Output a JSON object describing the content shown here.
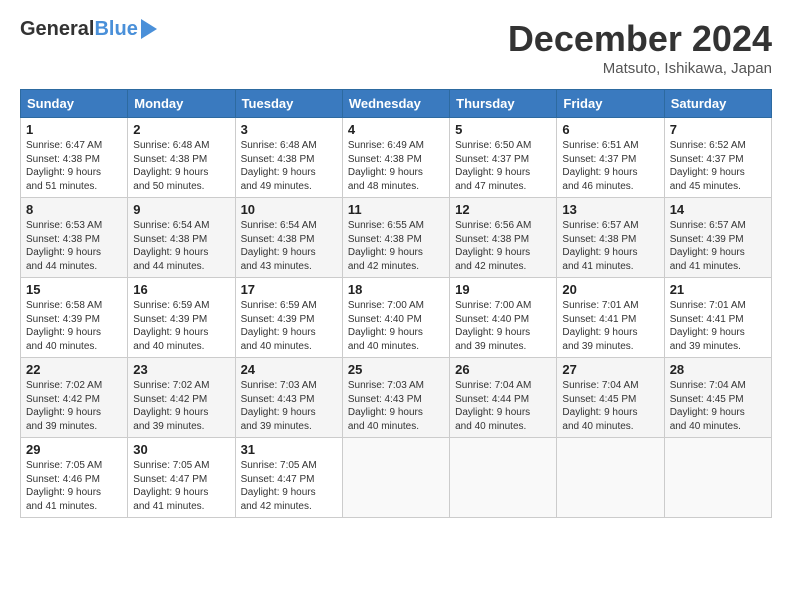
{
  "header": {
    "logo_general": "General",
    "logo_blue": "Blue",
    "title": "December 2024",
    "location": "Matsuto, Ishikawa, Japan"
  },
  "days_of_week": [
    "Sunday",
    "Monday",
    "Tuesday",
    "Wednesday",
    "Thursday",
    "Friday",
    "Saturday"
  ],
  "weeks": [
    [
      {
        "day": "1",
        "info": "Sunrise: 6:47 AM\nSunset: 4:38 PM\nDaylight: 9 hours\nand 51 minutes."
      },
      {
        "day": "2",
        "info": "Sunrise: 6:48 AM\nSunset: 4:38 PM\nDaylight: 9 hours\nand 50 minutes."
      },
      {
        "day": "3",
        "info": "Sunrise: 6:48 AM\nSunset: 4:38 PM\nDaylight: 9 hours\nand 49 minutes."
      },
      {
        "day": "4",
        "info": "Sunrise: 6:49 AM\nSunset: 4:38 PM\nDaylight: 9 hours\nand 48 minutes."
      },
      {
        "day": "5",
        "info": "Sunrise: 6:50 AM\nSunset: 4:37 PM\nDaylight: 9 hours\nand 47 minutes."
      },
      {
        "day": "6",
        "info": "Sunrise: 6:51 AM\nSunset: 4:37 PM\nDaylight: 9 hours\nand 46 minutes."
      },
      {
        "day": "7",
        "info": "Sunrise: 6:52 AM\nSunset: 4:37 PM\nDaylight: 9 hours\nand 45 minutes."
      }
    ],
    [
      {
        "day": "8",
        "info": "Sunrise: 6:53 AM\nSunset: 4:38 PM\nDaylight: 9 hours\nand 44 minutes."
      },
      {
        "day": "9",
        "info": "Sunrise: 6:54 AM\nSunset: 4:38 PM\nDaylight: 9 hours\nand 44 minutes."
      },
      {
        "day": "10",
        "info": "Sunrise: 6:54 AM\nSunset: 4:38 PM\nDaylight: 9 hours\nand 43 minutes."
      },
      {
        "day": "11",
        "info": "Sunrise: 6:55 AM\nSunset: 4:38 PM\nDaylight: 9 hours\nand 42 minutes."
      },
      {
        "day": "12",
        "info": "Sunrise: 6:56 AM\nSunset: 4:38 PM\nDaylight: 9 hours\nand 42 minutes."
      },
      {
        "day": "13",
        "info": "Sunrise: 6:57 AM\nSunset: 4:38 PM\nDaylight: 9 hours\nand 41 minutes."
      },
      {
        "day": "14",
        "info": "Sunrise: 6:57 AM\nSunset: 4:39 PM\nDaylight: 9 hours\nand 41 minutes."
      }
    ],
    [
      {
        "day": "15",
        "info": "Sunrise: 6:58 AM\nSunset: 4:39 PM\nDaylight: 9 hours\nand 40 minutes."
      },
      {
        "day": "16",
        "info": "Sunrise: 6:59 AM\nSunset: 4:39 PM\nDaylight: 9 hours\nand 40 minutes."
      },
      {
        "day": "17",
        "info": "Sunrise: 6:59 AM\nSunset: 4:39 PM\nDaylight: 9 hours\nand 40 minutes."
      },
      {
        "day": "18",
        "info": "Sunrise: 7:00 AM\nSunset: 4:40 PM\nDaylight: 9 hours\nand 40 minutes."
      },
      {
        "day": "19",
        "info": "Sunrise: 7:00 AM\nSunset: 4:40 PM\nDaylight: 9 hours\nand 39 minutes."
      },
      {
        "day": "20",
        "info": "Sunrise: 7:01 AM\nSunset: 4:41 PM\nDaylight: 9 hours\nand 39 minutes."
      },
      {
        "day": "21",
        "info": "Sunrise: 7:01 AM\nSunset: 4:41 PM\nDaylight: 9 hours\nand 39 minutes."
      }
    ],
    [
      {
        "day": "22",
        "info": "Sunrise: 7:02 AM\nSunset: 4:42 PM\nDaylight: 9 hours\nand 39 minutes."
      },
      {
        "day": "23",
        "info": "Sunrise: 7:02 AM\nSunset: 4:42 PM\nDaylight: 9 hours\nand 39 minutes."
      },
      {
        "day": "24",
        "info": "Sunrise: 7:03 AM\nSunset: 4:43 PM\nDaylight: 9 hours\nand 39 minutes."
      },
      {
        "day": "25",
        "info": "Sunrise: 7:03 AM\nSunset: 4:43 PM\nDaylight: 9 hours\nand 40 minutes."
      },
      {
        "day": "26",
        "info": "Sunrise: 7:04 AM\nSunset: 4:44 PM\nDaylight: 9 hours\nand 40 minutes."
      },
      {
        "day": "27",
        "info": "Sunrise: 7:04 AM\nSunset: 4:45 PM\nDaylight: 9 hours\nand 40 minutes."
      },
      {
        "day": "28",
        "info": "Sunrise: 7:04 AM\nSunset: 4:45 PM\nDaylight: 9 hours\nand 40 minutes."
      }
    ],
    [
      {
        "day": "29",
        "info": "Sunrise: 7:05 AM\nSunset: 4:46 PM\nDaylight: 9 hours\nand 41 minutes."
      },
      {
        "day": "30",
        "info": "Sunrise: 7:05 AM\nSunset: 4:47 PM\nDaylight: 9 hours\nand 41 minutes."
      },
      {
        "day": "31",
        "info": "Sunrise: 7:05 AM\nSunset: 4:47 PM\nDaylight: 9 hours\nand 42 minutes."
      },
      {
        "day": "",
        "info": ""
      },
      {
        "day": "",
        "info": ""
      },
      {
        "day": "",
        "info": ""
      },
      {
        "day": "",
        "info": ""
      }
    ]
  ]
}
